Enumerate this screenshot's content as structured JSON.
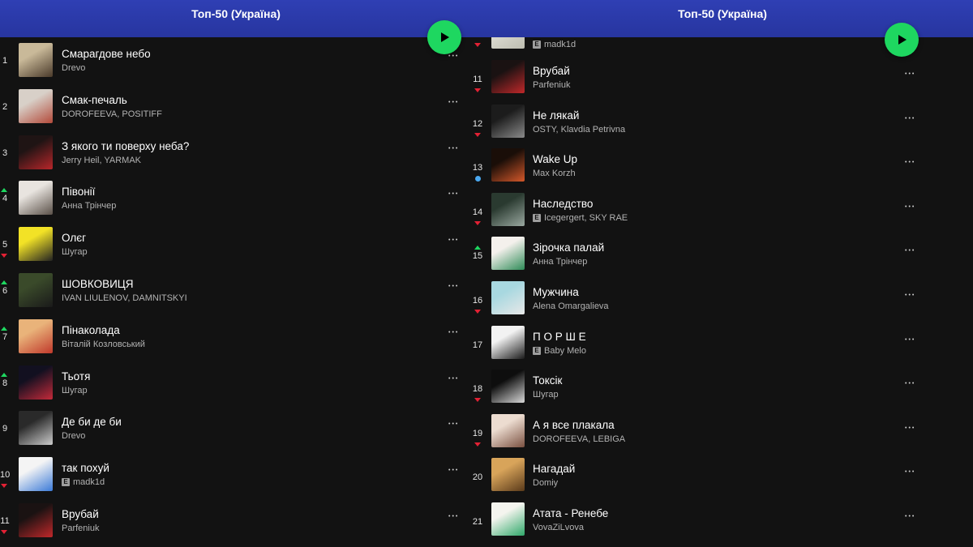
{
  "left": {
    "playlist_title": "Топ-50 (Україна)",
    "tracks": [
      {
        "rank": "1",
        "title": "Смарагдове небо",
        "artist": "Drevo",
        "explicit": false,
        "trend": "none",
        "cover": [
          "#c9b999",
          "#4a3a2a"
        ]
      },
      {
        "rank": "2",
        "title": "Смак-печаль",
        "artist": "DOROFEEVA, POSITIFF",
        "explicit": false,
        "trend": "none",
        "cover": [
          "#d8d0c8",
          "#b34a3a"
        ]
      },
      {
        "rank": "3",
        "title": "З якого ти поверху неба?",
        "artist": "Jerry Heil, YARMAK",
        "explicit": false,
        "trend": "none",
        "cover": [
          "#1f1414",
          "#b8262a"
        ]
      },
      {
        "rank": "4",
        "title": "Півонії",
        "artist": "Анна Трінчер",
        "explicit": false,
        "trend": "up",
        "cover": [
          "#e8e4df",
          "#5a5048"
        ]
      },
      {
        "rank": "5",
        "title": "Олєг",
        "artist": "Шугар",
        "explicit": false,
        "trend": "down",
        "cover": [
          "#f2e226",
          "#222222"
        ]
      },
      {
        "rank": "6",
        "title": "ШОВКОВИЦЯ",
        "artist": "IVAN LIULENOV, DAMNITSKYI",
        "explicit": false,
        "trend": "up",
        "cover": [
          "#3a4a2a",
          "#1a1a1a"
        ]
      },
      {
        "rank": "7",
        "title": "Пінаколада",
        "artist": "Віталій Козловський",
        "explicit": false,
        "trend": "up",
        "cover": [
          "#e9b37a",
          "#c0392b"
        ]
      },
      {
        "rank": "8",
        "title": "Тьотя",
        "artist": "Шугар",
        "explicit": false,
        "trend": "up",
        "cover": [
          "#121020",
          "#c42a3a"
        ]
      },
      {
        "rank": "9",
        "title": "Де би де би",
        "artist": "Drevo",
        "explicit": false,
        "trend": "none",
        "cover": [
          "#2a2a2a",
          "#cccccc"
        ]
      },
      {
        "rank": "10",
        "title": "так похуй",
        "artist": "madk1d",
        "explicit": true,
        "trend": "down",
        "cover": [
          "#f4f4f4",
          "#3b7bd8"
        ]
      },
      {
        "rank": "11",
        "title": "Врубай",
        "artist": "Parfeniuk",
        "explicit": false,
        "trend": "down",
        "cover": [
          "#1a1212",
          "#c0282a"
        ]
      }
    ]
  },
  "right": {
    "playlist_title": "Топ-50 (Україна)",
    "partial_top": {
      "artist": "madk1d",
      "explicit": true,
      "trend": "down",
      "cover": [
        "#f0efe8",
        "#bdbdb0"
      ]
    },
    "tracks": [
      {
        "rank": "11",
        "title": "Врубай",
        "artist": "Parfeniuk",
        "explicit": false,
        "trend": "down",
        "cover": [
          "#1a1212",
          "#c0282a"
        ]
      },
      {
        "rank": "12",
        "title": "Не лякай",
        "artist": "OSTY, Klavdia Petrivna",
        "explicit": false,
        "trend": "down",
        "cover": [
          "#1c1c1c",
          "#8a8a8a"
        ]
      },
      {
        "rank": "13",
        "title": "Wake Up",
        "artist": "Max Korzh",
        "explicit": false,
        "trend": "new",
        "cover": [
          "#1a0e08",
          "#d4582a"
        ]
      },
      {
        "rank": "14",
        "title": "Наследство",
        "artist": "Icegergert, SKY RAE",
        "explicit": true,
        "trend": "down",
        "cover": [
          "#2a3a30",
          "#9aa8a0"
        ]
      },
      {
        "rank": "15",
        "title": "Зірочка палай",
        "artist": "Анна Трінчер",
        "explicit": false,
        "trend": "up",
        "cover": [
          "#f4f0ec",
          "#2e8b57"
        ]
      },
      {
        "rank": "16",
        "title": "Мужчина",
        "artist": "Alena Omargalieva",
        "explicit": false,
        "trend": "down",
        "cover": [
          "#a8d8e0",
          "#e8e8e8"
        ]
      },
      {
        "rank": "17",
        "title": "П О Р Ш Е",
        "artist": "Baby Melo",
        "explicit": true,
        "trend": "none",
        "cover": [
          "#f2f2f2",
          "#1a1a1a"
        ]
      },
      {
        "rank": "18",
        "title": "Токсік",
        "artist": "Шугар",
        "explicit": false,
        "trend": "down",
        "cover": [
          "#0e0e0e",
          "#d9d9d9"
        ]
      },
      {
        "rank": "19",
        "title": "А я все плакала",
        "artist": "DOROFEEVA, LEBIGA",
        "explicit": false,
        "trend": "down",
        "cover": [
          "#ecdcd0",
          "#7a5040"
        ]
      },
      {
        "rank": "20",
        "title": "Нагадай",
        "artist": "Domiy",
        "explicit": false,
        "trend": "none",
        "cover": [
          "#d8a45a",
          "#5a3a1a"
        ]
      },
      {
        "rank": "21",
        "title": "Атата - Ренебе",
        "artist": "VovaZiLvova",
        "explicit": false,
        "trend": "none",
        "cover": [
          "#f4f4ee",
          "#2fa86a"
        ]
      }
    ]
  },
  "colors": {
    "accent_green": "#1ed760",
    "header_blue": "#2f3fb4",
    "trend_down": "#e22134",
    "trend_new": "#4aa8f0"
  },
  "icons": {
    "play": "play-icon",
    "more": "more-options-icon",
    "explicit": "E"
  }
}
